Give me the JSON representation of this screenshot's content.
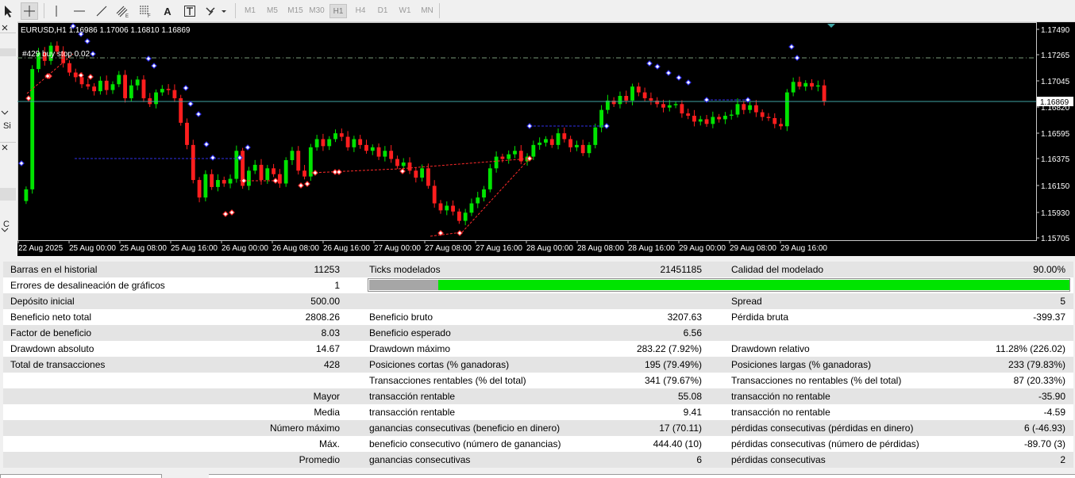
{
  "toolbar": {
    "tools": [
      "cursor-icon",
      "crosshair-icon",
      "vertical-line-icon",
      "horizontal-line-icon",
      "trendline-icon",
      "equidistant-channel-icon",
      "fibonacci-icon",
      "text-icon",
      "text-label-icon",
      "shapes-icon"
    ],
    "text_tool_label": "A",
    "timeframes": [
      "M1",
      "M5",
      "M15",
      "M30",
      "H1",
      "H4",
      "D1",
      "W1",
      "MN"
    ],
    "active_timeframe": "H1"
  },
  "left_strip": {
    "label1": "Si",
    "label2": "C"
  },
  "chart": {
    "symbol_label": "EURUSD,H1",
    "ohlc": "1.16986 1.17006 1.16810 1.16869",
    "order_label": "#429 buy stop 0.02",
    "price_ticks": [
      "1.17490",
      "1.17265",
      "1.17045",
      "1.16820",
      "1.16595",
      "1.16375",
      "1.16150",
      "1.15930",
      "1.15705"
    ],
    "current_price": "1.16869",
    "time_ticks": [
      "22 Aug 2025",
      "25 Aug 00:00",
      "25 Aug 08:00",
      "25 Aug 16:00",
      "26 Aug 00:00",
      "26 Aug 08:00",
      "26 Aug 16:00",
      "27 Aug 00:00",
      "27 Aug 08:00",
      "27 Aug 16:00",
      "28 Aug 00:00",
      "28 Aug 08:00",
      "28 Aug 16:00",
      "29 Aug 00:00",
      "29 Aug 08:00",
      "29 Aug 16:00"
    ],
    "colors": {
      "bull": "#00e400",
      "bear": "#ff1e1e",
      "grid": "#7a9d7a",
      "bid_line": "#3fa3a3",
      "order_line": "#2f2fe8",
      "stop_line": "#ff2a2a"
    }
  },
  "report": {
    "rows": [
      {
        "c1l": "Barras en el historial",
        "c1v": "11253",
        "c2l": "Ticks modelados",
        "c2v": "21451185",
        "c3l": "Calidad del modelado",
        "c3v": "90.00%"
      },
      {
        "c1l": "Errores de desalineación de gráficos",
        "c1v": "1",
        "bar": true,
        "quality_fraction": 0.9
      },
      {
        "c1l": "Depósito inicial",
        "c1v": "500.00",
        "c2l": "",
        "c2v": "",
        "c3l": "Spread",
        "c3v": "5"
      },
      {
        "c1l": "Beneficio neto total",
        "c1v": "2808.26",
        "c2l": "Beneficio bruto",
        "c2v": "3207.63",
        "c3l": "Pérdida bruta",
        "c3v": "-399.37"
      },
      {
        "c1l": "Factor de beneficio",
        "c1v": "8.03",
        "c2l": "Beneficio esperado",
        "c2v": "6.56",
        "c3l": "",
        "c3v": ""
      },
      {
        "c1l": "Drawdown absoluto",
        "c1v": "14.67",
        "c2l": "Drawdown máximo",
        "c2v": "283.22 (7.92%)",
        "c3l": "Drawdown relativo",
        "c3v": "11.28% (226.02)"
      },
      {
        "c1l": "Total de transacciones",
        "c1v": "428",
        "c2l": "Posiciones cortas (% ganadoras)",
        "c2v": "195 (79.49%)",
        "c3l": "Posiciones largas (% ganadoras)",
        "c3v": "233 (79.83%)"
      },
      {
        "c1l": "",
        "c1v": "",
        "c2l": "Transacciones rentables (% del total)",
        "c2v": "341 (79.67%)",
        "c3l": "Transacciones no rentables (% del total)",
        "c3v": "87 (20.33%)"
      },
      {
        "c1l": "",
        "c1v": "Mayor",
        "c2l": "transacción rentable",
        "c2v": "55.08",
        "c3l": "transacción no rentable",
        "c3v": "-35.90"
      },
      {
        "c1l": "",
        "c1v": "Media",
        "c2l": "transacción rentable",
        "c2v": "9.41",
        "c3l": "transacción no rentable",
        "c3v": "-4.59"
      },
      {
        "c1l": "",
        "c1v": "Número máximo",
        "c2l": "ganancias consecutivas (beneficio en dinero)",
        "c2v": "17 (70.11)",
        "c3l": "pérdidas consecutivas (pérdidas en dinero)",
        "c3v": "6 (-46.93)"
      },
      {
        "c1l": "",
        "c1v": "Máx.",
        "c2l": "beneficio consecutivo (número de ganancias)",
        "c2v": "444.40 (10)",
        "c3l": "pérdidas consecutivas (número de pérdidas)",
        "c3v": "-89.70 (3)"
      },
      {
        "c1l": "",
        "c1v": "Promedio",
        "c2l": "ganancias consecutivas",
        "c2v": "6",
        "c3l": "pérdidas consecutivas",
        "c3v": "2"
      }
    ]
  }
}
